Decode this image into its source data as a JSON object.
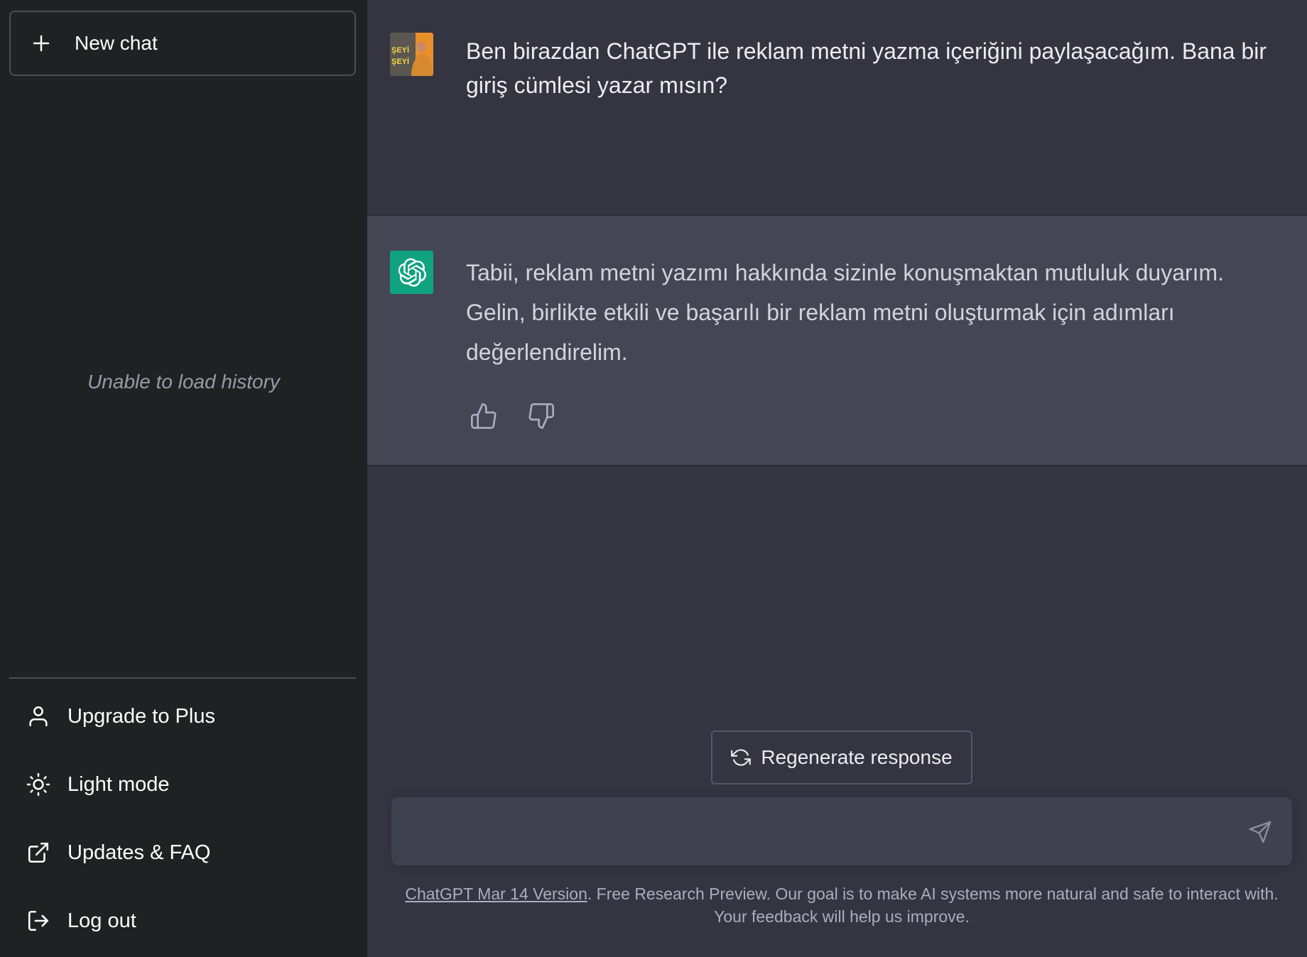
{
  "sidebar": {
    "new_chat_label": "New chat",
    "history_message": "Unable to load history",
    "menu": {
      "upgrade": "Upgrade to Plus",
      "light_mode": "Light mode",
      "updates": "Updates & FAQ",
      "logout": "Log out"
    }
  },
  "conversation": {
    "user_message": "Ben birazdan ChatGPT ile reklam metni yazma içeriğini paylaşacağım. Bana bir giriş cümlesi yazar mısın?",
    "assistant_message": "Tabii, reklam metni yazımı hakkında sizinle konuşmaktan mutluluk duyarım. Gelin, birlikte etkili ve başarılı bir reklam metni oluşturmak için adımları değerlendirelim.",
    "user_avatar_text": "ŞEYİ ŞEYİ"
  },
  "actions": {
    "regenerate_label": "Regenerate response"
  },
  "composer": {
    "placeholder": ""
  },
  "footer": {
    "version_link": "ChatGPT Mar 14 Version",
    "disclaimer": ". Free Research Preview. Our goal is to make AI systems more natural and safe to interact with. Your feedback will help us improve."
  },
  "colors": {
    "sidebar_bg": "#202123",
    "main_bg": "#343541",
    "assistant_bg": "#444654",
    "assistant_avatar": "#10a37f",
    "user_avatar_bg": "#e8902a"
  },
  "icons": {
    "new_chat": "plus-icon",
    "upgrade": "user-icon",
    "light_mode": "sun-icon",
    "updates": "external-link-icon",
    "logout": "logout-icon",
    "assistant": "openai-logo-icon",
    "thumbs_up": "thumbs-up-icon",
    "thumbs_down": "thumbs-down-icon",
    "regenerate": "refresh-icon",
    "send": "send-icon"
  }
}
